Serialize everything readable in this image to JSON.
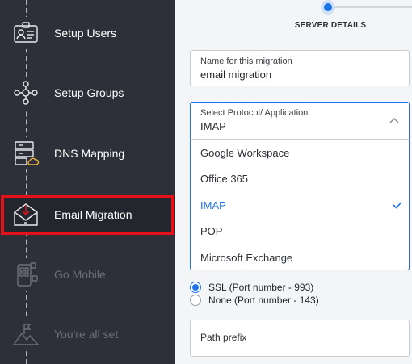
{
  "sidebar": {
    "steps": [
      {
        "label": "Setup Users",
        "icon": "id-card-icon",
        "state": "done"
      },
      {
        "label": "Setup Groups",
        "icon": "group-network-icon",
        "state": "done"
      },
      {
        "label": "DNS Mapping",
        "icon": "server-cloud-icon",
        "state": "done"
      },
      {
        "label": "Email Migration",
        "icon": "mail-download-icon",
        "state": "active"
      },
      {
        "label": "Go Mobile",
        "icon": "mobile-apps-icon",
        "state": "disabled"
      },
      {
        "label": "You're all set",
        "icon": "mountain-flag-icon",
        "state": "disabled"
      }
    ]
  },
  "main": {
    "section_title": "SERVER DETAILS",
    "migration_name": {
      "label": "Name for this migration",
      "value": "email migration"
    },
    "protocol": {
      "label": "Select Protocol/ Application",
      "value": "IMAP",
      "options": [
        "Google Workspace",
        "Office 365",
        "IMAP",
        "POP",
        "Microsoft Exchange"
      ],
      "selected_index": 2
    },
    "security": {
      "options": [
        {
          "label": "SSL (Port number - 993)",
          "checked": true
        },
        {
          "label": "None (Port number - 143)",
          "checked": false
        }
      ]
    },
    "path_prefix": {
      "placeholder": "Path prefix"
    }
  },
  "colors": {
    "accent": "#1a73e8",
    "highlight": "#e3121a",
    "sidebar_bg": "#2d3038"
  }
}
